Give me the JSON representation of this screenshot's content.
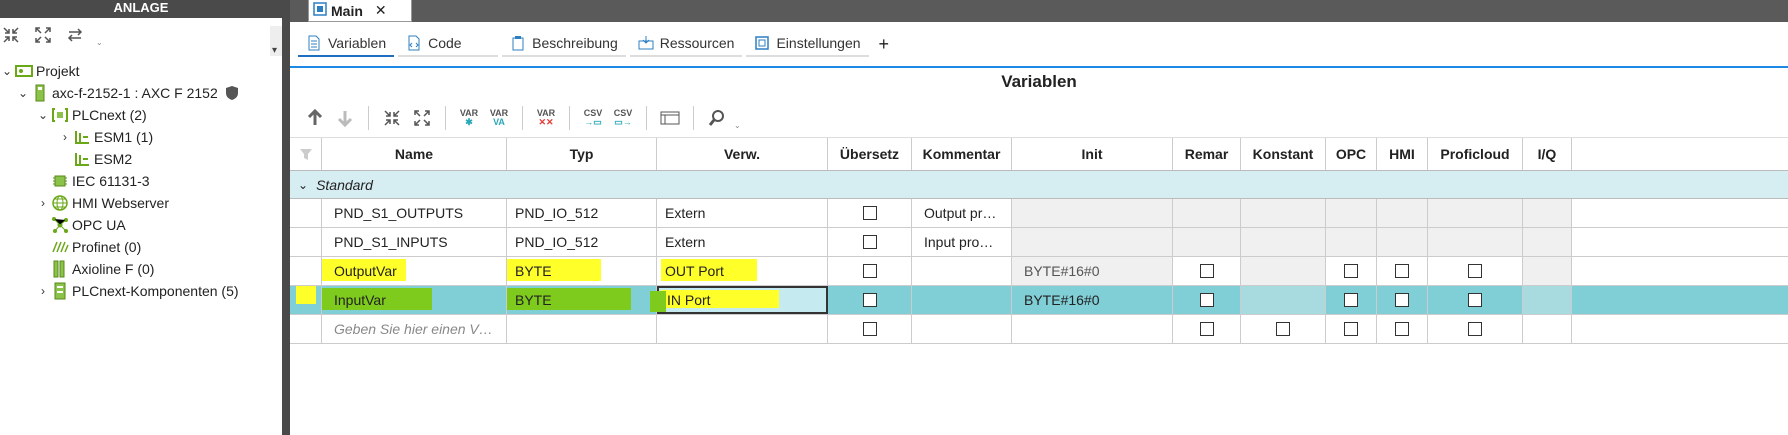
{
  "left_panel": {
    "title": "ANLAGE",
    "tree": [
      {
        "label": "Projekt",
        "level": 0,
        "expand": "v",
        "icon": "project-icon"
      },
      {
        "label": "axc-f-2152-1 : AXC F 2152",
        "level": 1,
        "expand": "v",
        "icon": "controller-icon"
      },
      {
        "label": "PLCnext (2)",
        "level": 2,
        "expand": "v",
        "icon": "plcnext-icon"
      },
      {
        "label": "ESM1 (1)",
        "level": 3,
        "expand": ">",
        "icon": "esm-icon"
      },
      {
        "label": "ESM2",
        "level": 3,
        "expand": "",
        "icon": "esm-icon"
      },
      {
        "label": "IEC 61131-3",
        "level": 2,
        "expand": "",
        "icon": "chip-icon"
      },
      {
        "label": "HMI Webserver",
        "level": 2,
        "expand": ">",
        "icon": "globe-icon"
      },
      {
        "label": "OPC UA",
        "level": 2,
        "expand": "",
        "icon": "opcua-icon"
      },
      {
        "label": "Profinet (0)",
        "level": 2,
        "expand": "",
        "icon": "profinet-icon"
      },
      {
        "label": "Axioline F (0)",
        "level": 2,
        "expand": "",
        "icon": "axioline-icon"
      },
      {
        "label": "PLCnext-Komponenten (5)",
        "level": 2,
        "expand": ">",
        "icon": "components-icon"
      }
    ]
  },
  "doc_tab": {
    "label": "Main",
    "close": "✕"
  },
  "sub_tabs": [
    {
      "label": "Variablen",
      "icon": "variables-icon"
    },
    {
      "label": "Code",
      "icon": "code-icon"
    },
    {
      "label": "Beschreibung",
      "icon": "clipboard-icon"
    },
    {
      "label": "Ressourcen",
      "icon": "resources-icon"
    },
    {
      "label": "Einstellungen",
      "icon": "settings-icon"
    }
  ],
  "add_tab": "+",
  "section_title": "Variablen",
  "toolbar": {
    "var": "VAR",
    "csv": "CSV"
  },
  "columns": [
    "Name",
    "Typ",
    "Verw.",
    "Übersetz",
    "Kommentar",
    "Init",
    "Remar",
    "Konstant",
    "OPC",
    "HMI",
    "Proficloud",
    "I/Q"
  ],
  "group": "Standard",
  "rows": [
    {
      "name": "PND_S1_OUTPUTS",
      "typ": "PND_IO_512",
      "verw": "Extern",
      "kommentar": "Output pr…",
      "init": ""
    },
    {
      "name": "PND_S1_INPUTS",
      "typ": "PND_IO_512",
      "verw": "Extern",
      "kommentar": "Input pro…",
      "init": ""
    },
    {
      "name": "OutputVar",
      "typ": "BYTE",
      "verw": "OUT Port",
      "kommentar": "",
      "init": "BYTE#16#0"
    },
    {
      "name": "InputVar",
      "typ": "BYTE",
      "verw": "IN Port",
      "kommentar": "",
      "init": "BYTE#16#0"
    }
  ],
  "new_row_placeholder": "Geben Sie hier einen V…"
}
